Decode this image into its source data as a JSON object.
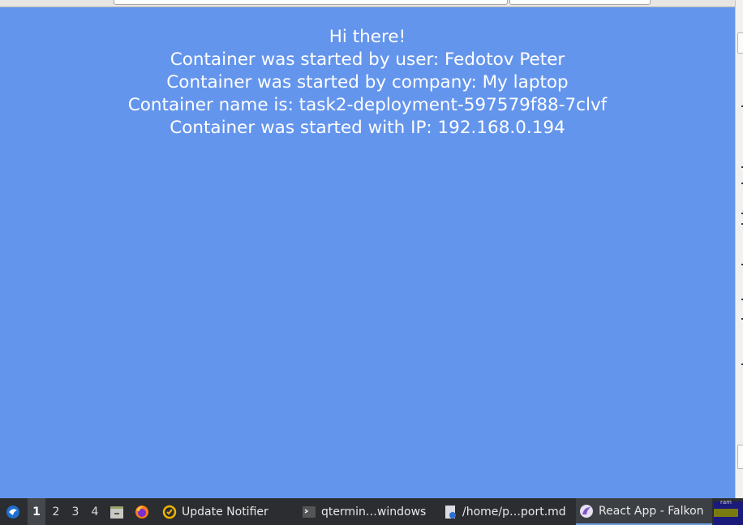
{
  "page": {
    "lines": [
      "Hi there!",
      "Container was started by user: Fedotov Peter",
      "Container was started by company: My laptop",
      "Container name is: task2-deployment-597579f88-7clvf",
      "Container was started with IP: 192.168.0.194"
    ],
    "background_color": "#6495ed",
    "text_color": "#ffffff"
  },
  "taskbar": {
    "desktops": [
      "1",
      "2",
      "3",
      "4"
    ],
    "active_desktop": "1",
    "tasks": [
      {
        "label": "Update Notifier",
        "icon": "update-notifier-icon"
      },
      {
        "label": "qtermin…windows",
        "icon": "terminal-icon"
      },
      {
        "label": "/home/p…port.md",
        "icon": "text-editor-icon"
      },
      {
        "label": "React App - Falkon",
        "icon": "falkon-icon"
      }
    ],
    "active_task": "React App - Falkon",
    "ram_label": "ram",
    "launchers": [
      "start-menu-icon",
      "file-manager-icon",
      "firefox-icon"
    ]
  }
}
